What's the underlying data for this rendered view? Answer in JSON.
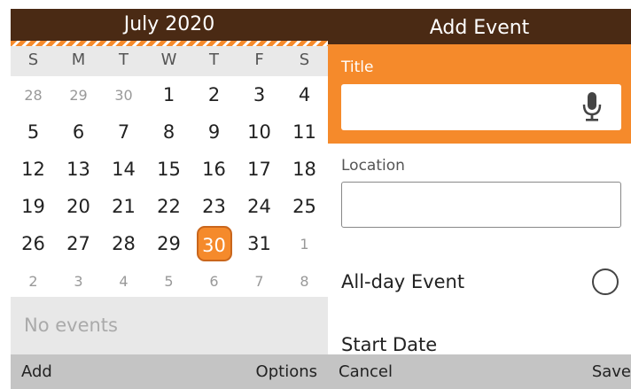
{
  "calendar": {
    "month_title": "July 2020",
    "weekdays": [
      "S",
      "M",
      "T",
      "W",
      "T",
      "F",
      "S"
    ],
    "weeks": [
      [
        {
          "d": "28",
          "m": true
        },
        {
          "d": "29",
          "m": true
        },
        {
          "d": "30",
          "m": true
        },
        {
          "d": "1"
        },
        {
          "d": "2"
        },
        {
          "d": "3"
        },
        {
          "d": "4"
        }
      ],
      [
        {
          "d": "5"
        },
        {
          "d": "6"
        },
        {
          "d": "7"
        },
        {
          "d": "8"
        },
        {
          "d": "9"
        },
        {
          "d": "10"
        },
        {
          "d": "11"
        }
      ],
      [
        {
          "d": "12"
        },
        {
          "d": "13"
        },
        {
          "d": "14"
        },
        {
          "d": "15"
        },
        {
          "d": "16"
        },
        {
          "d": "17"
        },
        {
          "d": "18"
        }
      ],
      [
        {
          "d": "19"
        },
        {
          "d": "20"
        },
        {
          "d": "21"
        },
        {
          "d": "22"
        },
        {
          "d": "23"
        },
        {
          "d": "24"
        },
        {
          "d": "25"
        }
      ],
      [
        {
          "d": "26"
        },
        {
          "d": "27"
        },
        {
          "d": "28"
        },
        {
          "d": "29"
        },
        {
          "d": "30",
          "sel": true
        },
        {
          "d": "31"
        },
        {
          "d": "1",
          "m": true
        }
      ],
      [
        {
          "d": "2",
          "m": true
        },
        {
          "d": "3",
          "m": true
        },
        {
          "d": "4",
          "m": true
        },
        {
          "d": "5",
          "m": true
        },
        {
          "d": "6",
          "m": true
        },
        {
          "d": "7",
          "m": true
        },
        {
          "d": "8",
          "m": true
        }
      ]
    ],
    "selected_day": "30",
    "no_events_text": "No events",
    "softkeys": {
      "left": "Add",
      "right": "Options"
    }
  },
  "add_event": {
    "header_title": "Add Event",
    "title_label": "Title",
    "title_value": "",
    "location_label": "Location",
    "location_value": "",
    "allday_label": "All-day Event",
    "allday_checked": false,
    "start_date_label": "Start Date",
    "softkeys": {
      "left": "Cancel",
      "right": "Save"
    }
  },
  "colors": {
    "header_brown": "#4a2a14",
    "accent_orange": "#f58a2b",
    "softkey_gray": "#c4c4c4"
  },
  "icons": {
    "mic": "microphone-icon"
  }
}
